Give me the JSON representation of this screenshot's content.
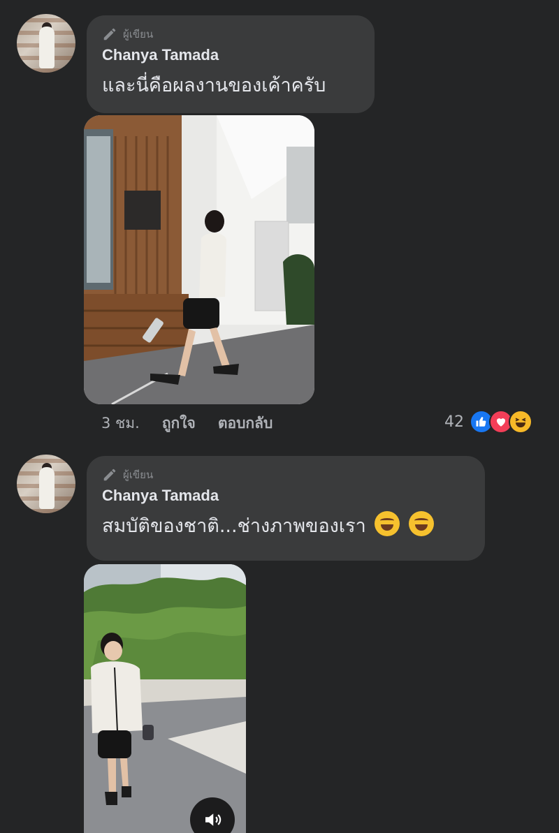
{
  "comments": [
    {
      "author_badge": "ผู้เขียน",
      "name": "Chanya Tamada",
      "text": "และนี่คือผลงานของเค้าครับ",
      "time": "3 ชม.",
      "like_label": "ถูกใจ",
      "reply_label": "ตอบกลับ",
      "reaction_count": "42",
      "reactions": [
        "like-icon",
        "love-icon",
        "haha-icon"
      ]
    },
    {
      "author_badge": "ผู้เขียน",
      "name": "Chanya Tamada",
      "text": "สมบัติของชาติ...ช่างภาพของเรา",
      "emojis": [
        "rofl-emoji",
        "rofl-emoji"
      ]
    }
  ],
  "colors": {
    "background": "#242526",
    "bubble": "#3a3b3c",
    "like": "#1877f2",
    "love": "#f33e58",
    "haha": "#f7b928"
  }
}
